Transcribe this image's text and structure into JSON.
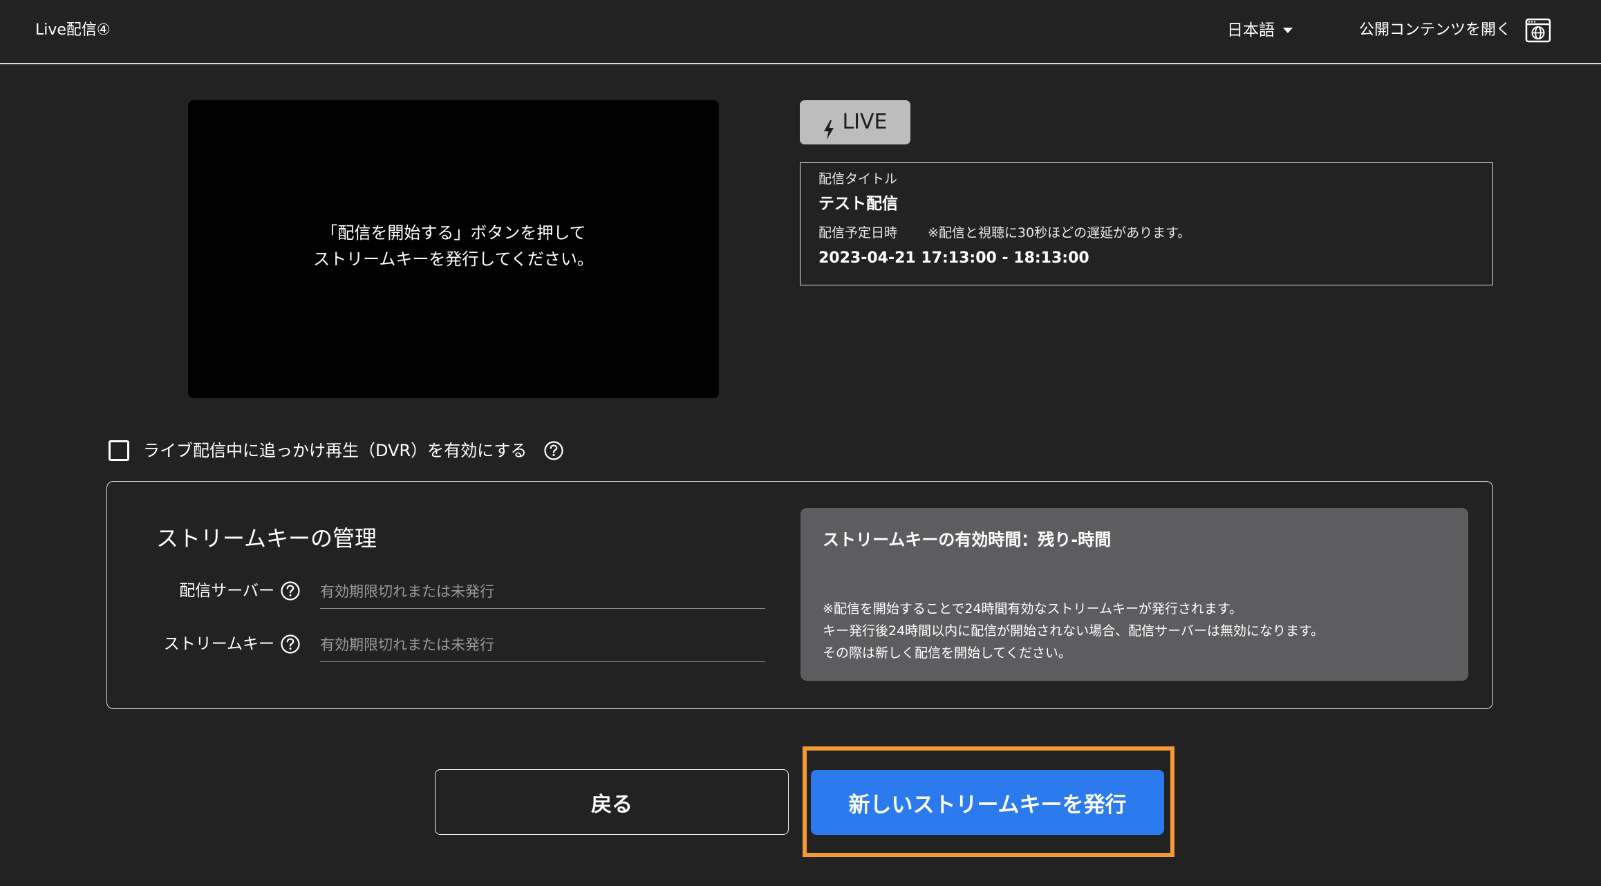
{
  "header": {
    "title": "Live配信④",
    "language": "日本語",
    "open_public_label": "公開コンテンツを開く"
  },
  "player": {
    "message_line1": "「配信を開始する」ボタンを押して",
    "message_line2": "ストリームキーを発行してください。"
  },
  "live_badge": {
    "label": "LIVE"
  },
  "info": {
    "title_label": "配信タイトル",
    "title": "テスト配信",
    "date_label": "配信予定日時",
    "delay_note": "※配信と視聴に30秒ほどの遅延があります。",
    "date": "2023-04-21 17:13:00 - 18:13:00"
  },
  "dvr": {
    "label": "ライブ配信中に追っかけ再生（DVR）を有効にする",
    "checked": false
  },
  "stream_key_management": {
    "heading": "ストリームキーの管理",
    "server_label": "配信サーバー",
    "server_placeholder": "有効期限切れまたは未発行",
    "key_label": "ストリームキー",
    "key_placeholder": "有効期限切れまたは未発行",
    "validity_title": "ストリームキーの有効時間：残り-時間",
    "note_line1": "※配信を開始することで24時間有効なストリームキーが発行されます。",
    "note_line2": "キー発行後24時間以内に配信が開始されない場合、配信サーバーは無効になります。",
    "note_line3": "その際は新しく配信を開始してください。"
  },
  "buttons": {
    "back": "戻る",
    "issue_new_key": "新しいストリームキーを発行"
  },
  "colors": {
    "background": "#222222",
    "primary": "#2b7bef",
    "highlight": "#f39a34",
    "live_badge": "#bdbdbd",
    "info_panel": "#5d5d60"
  },
  "icons": {
    "language_dropdown": "chevron-down-icon",
    "open_public": "globe-window-icon",
    "live": "bolt-icon",
    "help": "question-circle-icon"
  }
}
